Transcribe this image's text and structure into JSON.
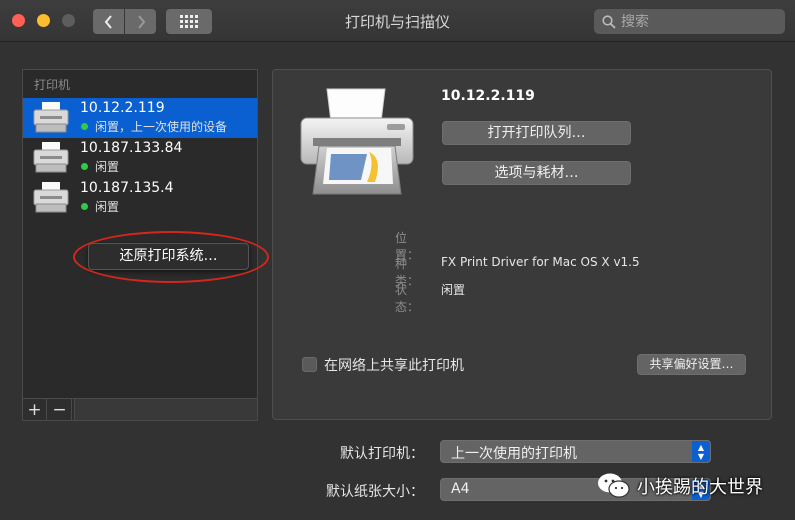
{
  "window": {
    "title": "打印机与扫描仪"
  },
  "toolbar": {
    "back_icon": "chevron-left-icon",
    "forward_icon": "chevron-right-icon",
    "grid_icon": "show-all-grid-icon",
    "search_placeholder": "搜索"
  },
  "sidebar": {
    "header": "打印机",
    "printers": [
      {
        "name": "10.12.2.119",
        "status": "闲置，上一次使用的设备",
        "selected": true
      },
      {
        "name": "10.187.133.84",
        "status": "闲置",
        "selected": false
      },
      {
        "name": "10.187.135.4",
        "status": "闲置",
        "selected": false
      }
    ],
    "add_label": "+",
    "remove_label": "−",
    "reset_button": "还原打印系统…"
  },
  "detail": {
    "printer_name": "10.12.2.119",
    "open_queue_button": "打开打印队列…",
    "options_button": "选项与耗材…",
    "location_label": "位置：",
    "location_value": "",
    "kind_label": "种类：",
    "kind_value": "FX Print Driver for Mac OS X v1.5",
    "state_label": "状态：",
    "state_value": "闲置",
    "share_checkbox_label": "在网络上共享此打印机",
    "share_checked": false,
    "share_pref_button": "共享偏好设置…"
  },
  "defaults": {
    "default_printer_label": "默认打印机：",
    "default_printer_value": "上一次使用的打印机",
    "default_paper_label": "默认纸张大小：",
    "default_paper_value": "A4"
  },
  "watermark": {
    "text": "小挨踢的大世界"
  },
  "colors": {
    "selection": "#0a60d0",
    "status_green": "#31c94b",
    "annotation_red": "#d4261b"
  }
}
